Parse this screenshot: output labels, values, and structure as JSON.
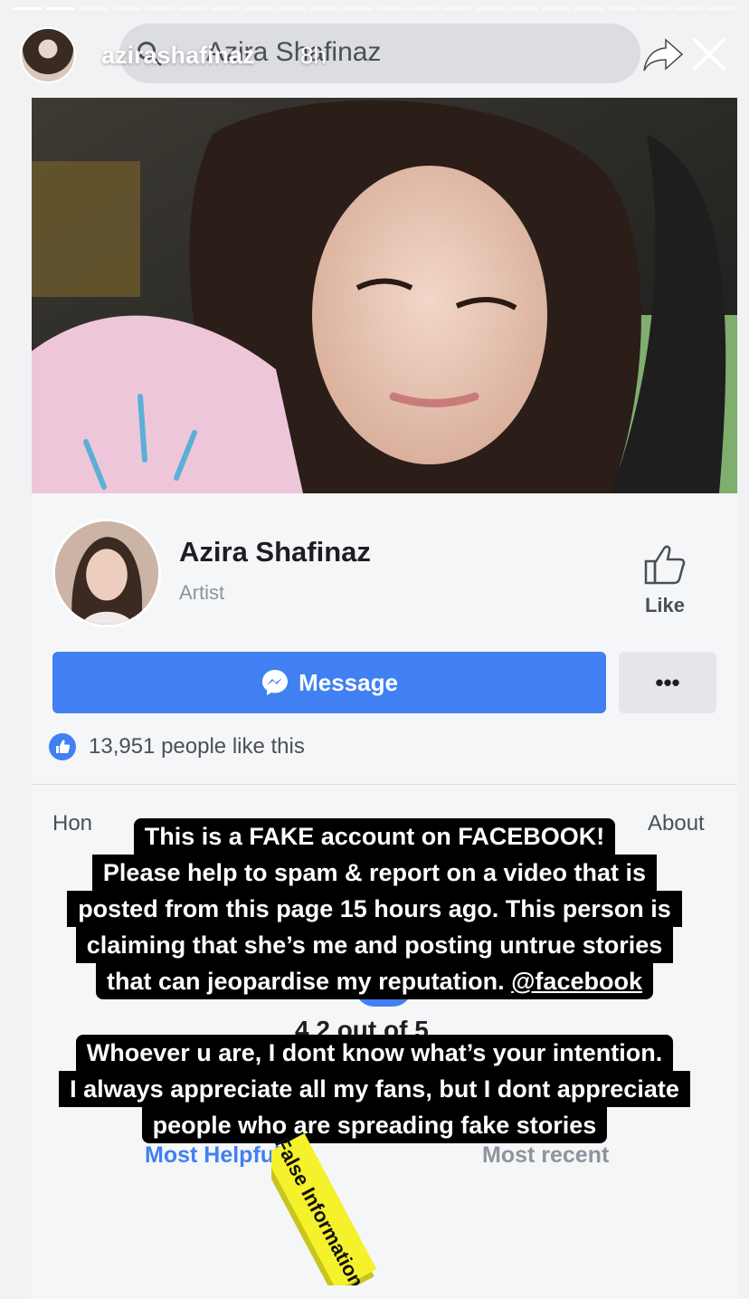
{
  "story": {
    "username": "azirashafinaz",
    "time_ago": "8h",
    "progress_total_segments": 22,
    "progress_active_segments": 2
  },
  "facebook": {
    "search": {
      "query": "Azira Shafinaz"
    },
    "page": {
      "name": "Azira Shafinaz",
      "category": "Artist",
      "like_label": "Like",
      "message_label": "Message",
      "more_label": "•••",
      "likes_text": "13,951 people like this"
    },
    "tabs": {
      "home_partial": "Hon",
      "about_partial": "About"
    },
    "reviews": {
      "rating_text": "4.2 out of 5",
      "sort_most_helpful": "Most Helpful",
      "sort_most_recent": "Most recent"
    }
  },
  "captions": {
    "block1": [
      "This is a FAKE account on FACEBOOK!",
      "Please help to spam & report on a video that is",
      "posted from this page 15 hours ago. This person is",
      "claiming that she’s me and posting untrue stories",
      "that can jeopardise my reputation."
    ],
    "block1_mention": "@facebook",
    "block2": [
      "Whoever u are, I dont know what’s your intention.",
      "I always appreciate all my fans, but I dont appreciate",
      "people who are spreading fake stories"
    ]
  },
  "sticker": {
    "text": "False Information",
    "color": "#f5f12a"
  },
  "colors": {
    "facebook_blue": "#4080f2",
    "caption_bg": "#000000"
  }
}
